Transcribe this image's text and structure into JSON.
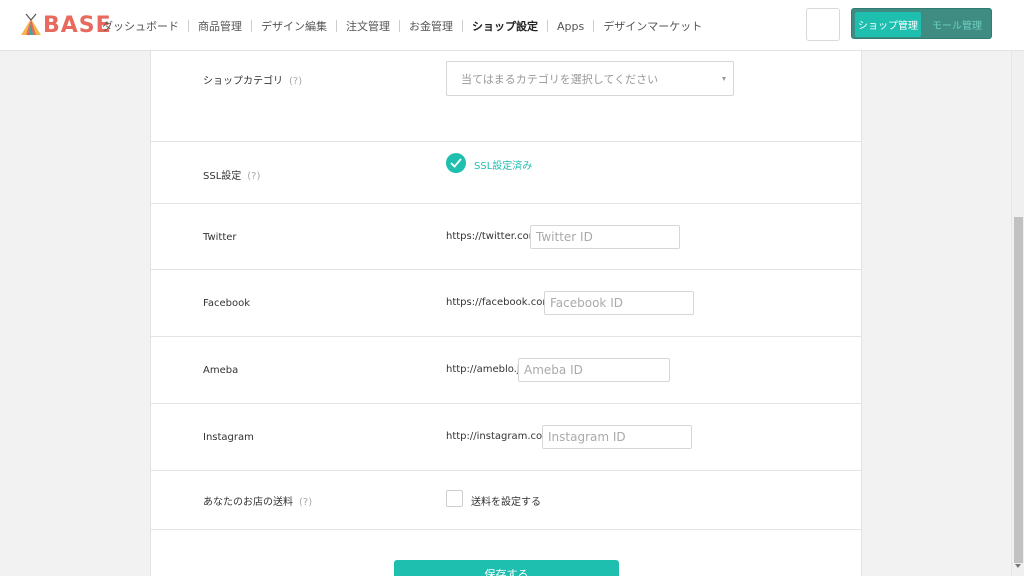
{
  "header": {
    "logo_text": "BASE",
    "nav": [
      {
        "label": "ダッシュボード"
      },
      {
        "label": "商品管理"
      },
      {
        "label": "デザイン編集"
      },
      {
        "label": "注文管理"
      },
      {
        "label": "お金管理"
      },
      {
        "label": "ショップ設定",
        "active": true
      },
      {
        "label": "Apps"
      },
      {
        "label": "デザインマーケット"
      }
    ],
    "toggle": {
      "shop_label": "ショップ管理",
      "mall_label": "モール管理"
    }
  },
  "form": {
    "shop_category": {
      "label": "ショップカテゴリ",
      "help": "(?)",
      "placeholder": "当てはまるカテゴリを選択してください"
    },
    "ssl": {
      "label": "SSL設定",
      "help": "(?)",
      "status": "SSL設定済み"
    },
    "twitter": {
      "label": "Twitter",
      "prefix": "https://twitter.com/",
      "placeholder": "Twitter ID"
    },
    "facebook": {
      "label": "Facebook",
      "prefix": "https://facebook.com/",
      "placeholder": "Facebook ID"
    },
    "ameba": {
      "label": "Ameba",
      "prefix": "http://ameblo.jp/",
      "placeholder": "Ameba ID"
    },
    "instagram": {
      "label": "Instagram",
      "prefix": "http://instagram.com/",
      "placeholder": "Instagram ID"
    },
    "shipping": {
      "label": "あなたのお店の送料",
      "help": "(?)",
      "checkbox_label": "送料を設定する"
    },
    "save_label": "保存する"
  },
  "colors": {
    "accent": "#1fbfb0",
    "toggle_bg": "#3e8c82"
  }
}
